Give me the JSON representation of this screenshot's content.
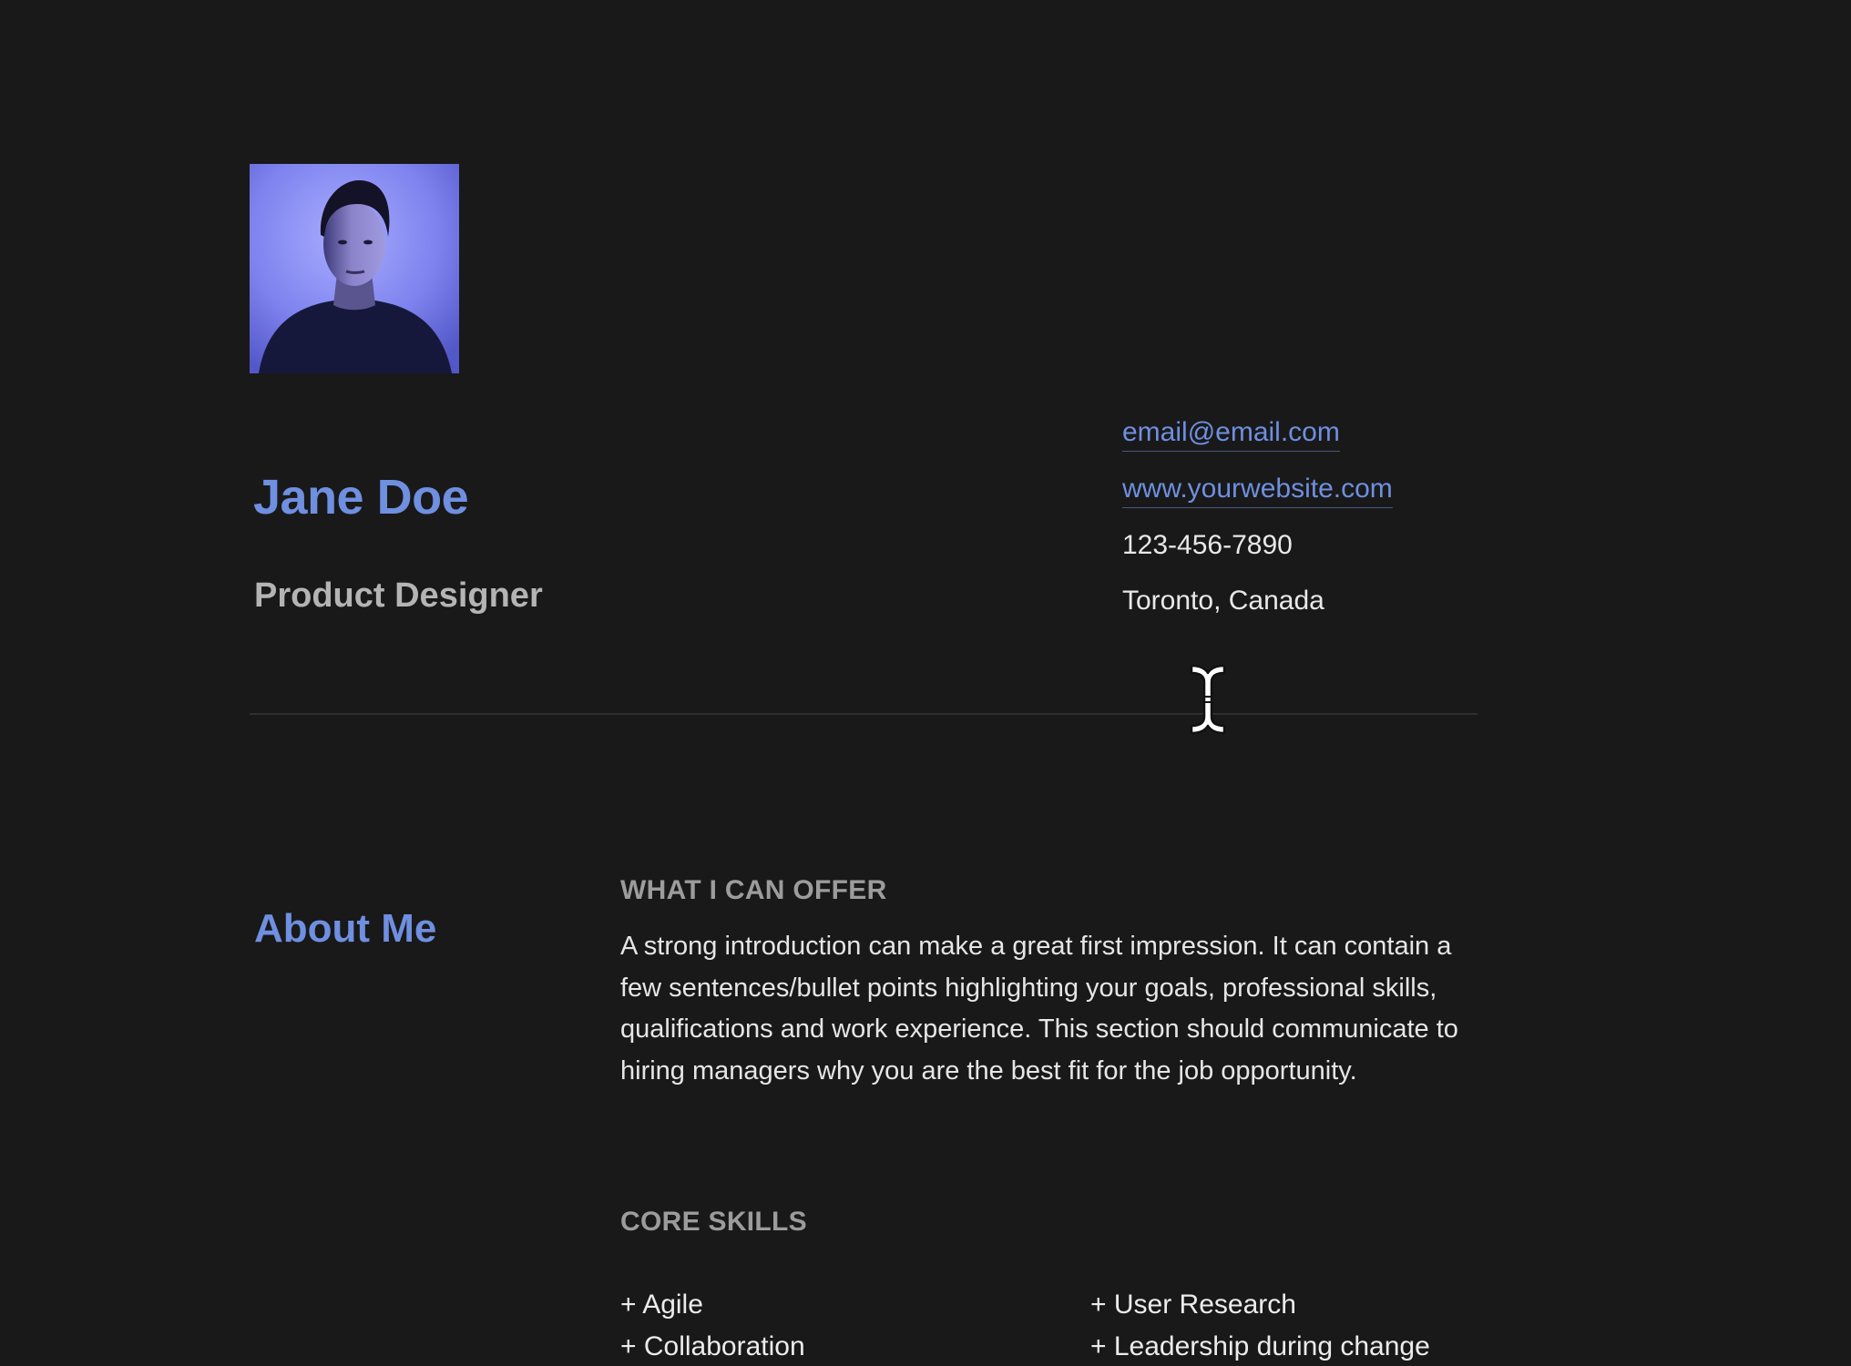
{
  "profile": {
    "photo_alt": "portrait",
    "name": "Jane Doe",
    "role": "Product Designer"
  },
  "contact": {
    "email": "email@email.com",
    "website": "www.yourwebsite.com",
    "phone": "123-456-7890",
    "location": "Toronto, Canada"
  },
  "about": {
    "title": "About Me",
    "offer_label": "WHAT I CAN OFFER",
    "intro": "A strong introduction can make a great first impression. It can contain a few sentences/bullet points highlighting your goals, professional skills, qualifications and work experience. This section should communicate to hiring managers why you are the best fit for the job opportunity.",
    "skills_label": "CORE SKILLS",
    "skills": [
      "+ Agile",
      "+ User Research",
      "+ Collaboration",
      "+ Leadership during change"
    ]
  },
  "colors": {
    "background": "#191919",
    "accent": "#6f8fe0",
    "muted": "#9c9c9c"
  }
}
